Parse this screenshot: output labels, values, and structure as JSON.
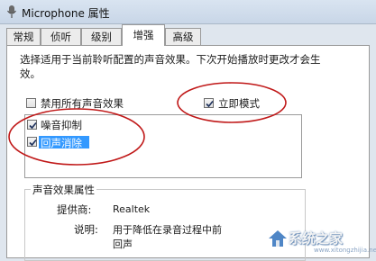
{
  "window": {
    "title": "Microphone 属性"
  },
  "tabs": [
    {
      "label": "常规"
    },
    {
      "label": "侦听"
    },
    {
      "label": "级别"
    },
    {
      "label": "增强",
      "active": true
    },
    {
      "label": "高级"
    }
  ],
  "description": {
    "line1": "选择适用于当前聆听配置的声音效果。下次开始播放时更改才会生",
    "line2": "效。"
  },
  "options": {
    "disable_all": {
      "label": "禁用所有声音效果",
      "checked": false
    },
    "immediate_mode": {
      "label": "立即模式",
      "checked": true
    }
  },
  "effects": [
    {
      "label": "噪音抑制",
      "checked": true,
      "selected": false
    },
    {
      "label": "回声消除",
      "checked": true,
      "selected": true
    }
  ],
  "properties": {
    "group_title": "声音效果属性",
    "provider_label": "提供商:",
    "provider_value": "Realtek",
    "description_label": "说明:",
    "description_line1": "用于降低在录音过程中前",
    "description_line2": "回声"
  },
  "annotation_color": "#c01818",
  "watermark": {
    "text": "系统之家",
    "url": "www.xitongzhijia.net"
  }
}
